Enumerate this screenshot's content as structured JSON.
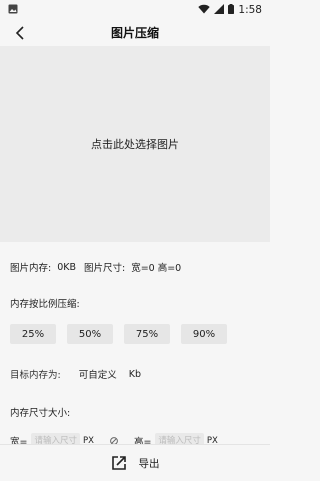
{
  "status_bar": {
    "time": "1:58"
  },
  "header": {
    "title": "图片压缩"
  },
  "preview": {
    "prompt": "点击此处选择图片"
  },
  "info": {
    "memory_label": "图片内存:",
    "memory_value": "0KB",
    "size_label": "图片尺寸:",
    "width_value": "宽=0",
    "height_value": "高=0"
  },
  "ratio": {
    "label": "内存按比例压缩:",
    "options": [
      "25%",
      "50%",
      "75%",
      "90%"
    ]
  },
  "target": {
    "label": "目标内存为:",
    "value_label": "可自定义",
    "unit": "Kb"
  },
  "dimension": {
    "label": "内存尺寸大小:",
    "width_label": "宽=",
    "width_placeholder": "请输入尺寸",
    "width_unit": "PX",
    "height_label": "高=",
    "height_placeholder": "请输入尺寸",
    "height_unit": "PX"
  },
  "bottom": {
    "export_label": "导出"
  }
}
